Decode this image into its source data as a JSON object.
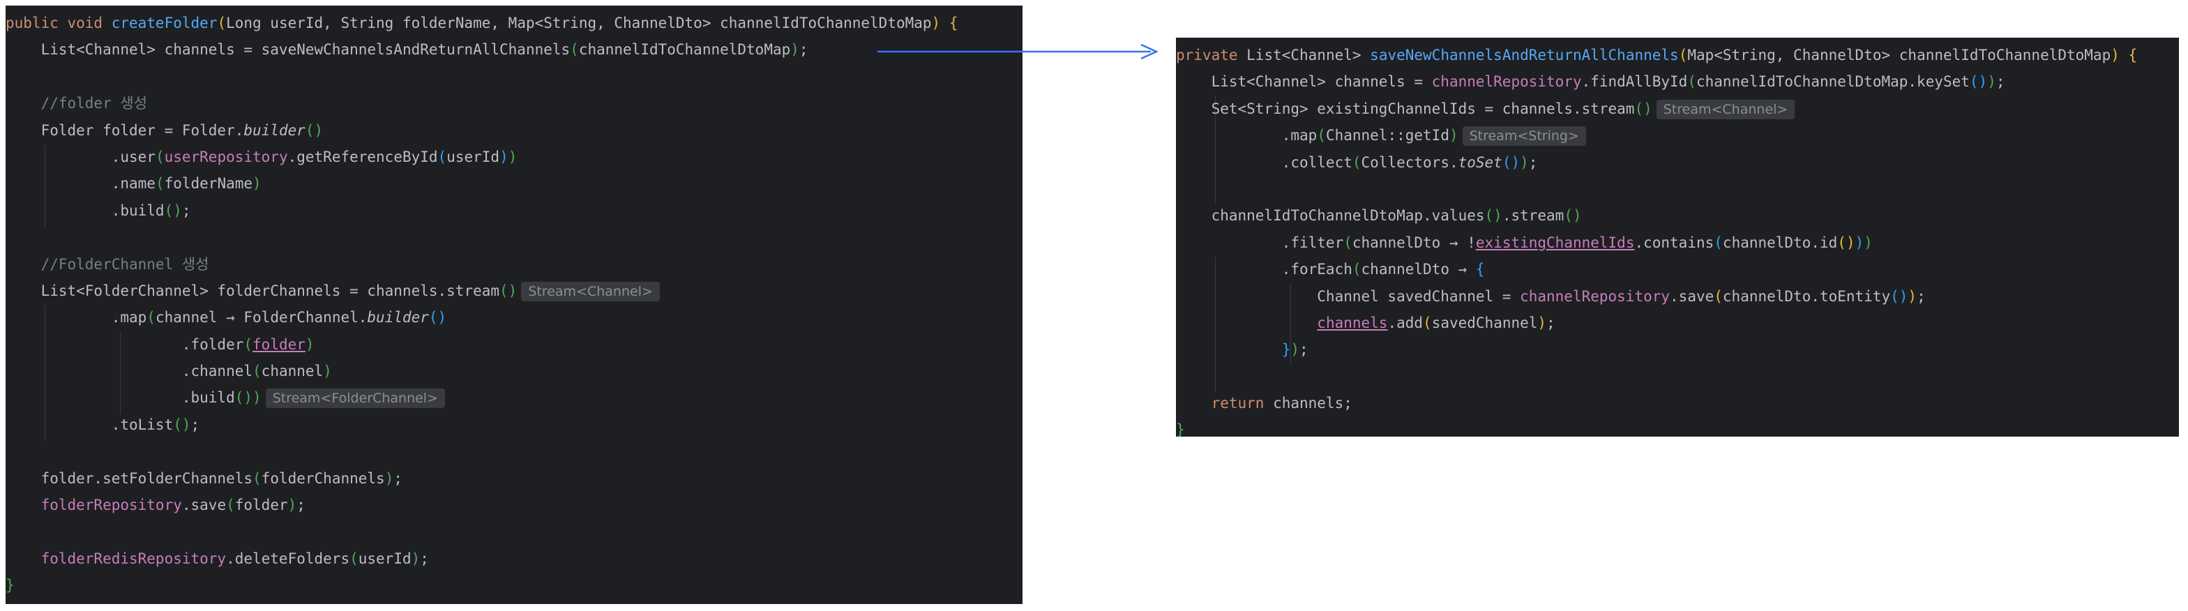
{
  "left": {
    "l1": {
      "t1": "public void ",
      "t2": "createFolder",
      "t3": "(",
      "t4": "Long userId, String folderName, Map<String, ChannelDto> channelIdToChannelDtoMap",
      "t5": ")",
      "t6": " {"
    },
    "l2": {
      "t1": "    List<Channel> channels = saveNewChannelsAndReturnAllChannels",
      "t2": "(",
      "t3": "channelIdToChannelDtoMap",
      "t4": ")",
      "t5": ";"
    },
    "l4": {
      "t1": "    //folder 생성"
    },
    "l5": {
      "t1": "    Folder folder = Folder.",
      "t2": "builder",
      "t3": "()"
    },
    "l6": {
      "t1": "            .user",
      "t2": "(",
      "t3": "userRepository",
      "t4": ".getReferenceById",
      "t5": "(",
      "t6": "userId",
      "t7": ")",
      "t8": ")"
    },
    "l7": {
      "t1": "            .name",
      "t2": "(",
      "t3": "folderName",
      "t4": ")"
    },
    "l8": {
      "t1": "            .build",
      "t2": "()",
      "t3": ";"
    },
    "l10": {
      "t1": "    //FolderChannel 생성"
    },
    "l11": {
      "t1": "    List<FolderChannel> folderChannels = channels.stream",
      "t2": "()",
      "hint": "Stream<Channel>"
    },
    "l12": {
      "t1": "            .map",
      "t2": "(",
      "t3": "channel → FolderChannel.",
      "t4": "builder",
      "t5": "()"
    },
    "l13": {
      "t1": "                    .folder",
      "t2": "(",
      "t3": "folder",
      "t4": ")"
    },
    "l14": {
      "t1": "                    .channel",
      "t2": "(",
      "t3": "channel",
      "t4": ")"
    },
    "l15": {
      "t1": "                    .build",
      "t2": "()",
      "t3": ")",
      "hint": "Stream<FolderChannel>"
    },
    "l16": {
      "t1": "            .toList",
      "t2": "()",
      "t3": ";"
    },
    "l18": {
      "t1": "    folder.setFolderChannels",
      "t2": "(",
      "t3": "folderChannels",
      "t4": ")",
      "t5": ";"
    },
    "l19": {
      "t1": "    folderRepository",
      "t2": ".save",
      "t3": "(",
      "t4": "folder",
      "t5": ")",
      "t6": ";"
    },
    "l21": {
      "t1": "    folderRedisRepository",
      "t2": ".deleteFolders",
      "t3": "(",
      "t4": "userId",
      "t5": ")",
      "t6": ";"
    },
    "l22": {
      "t1": "}"
    }
  },
  "right": {
    "r1": {
      "t1": "private ",
      "t2": "List<Channel> ",
      "t3": "saveNewChannelsAndReturnAllChannels",
      "t4": "(",
      "t5": "Map<String, ChannelDto> channelIdToChannelDtoMap",
      "t6": ")",
      "t7": " {"
    },
    "r2": {
      "t1": "    List<Channel> channels = ",
      "t2": "channelRepository",
      "t3": ".findAllById",
      "t4": "(",
      "t5": "channelIdToChannelDtoMap.keySet",
      "t6": "()",
      "t7": ")",
      "t8": ";"
    },
    "r3": {
      "t1": "    Set<String> existingChannelIds = channels.stream",
      "t2": "()",
      "hint": "Stream<Channel>"
    },
    "r4": {
      "t1": "            .map",
      "t2": "(",
      "t3": "Channel::getId",
      "t4": ")",
      "hint": "Stream<String>"
    },
    "r5": {
      "t1": "            .collect",
      "t2": "(",
      "t3": "Collectors.",
      "t4": "toSet",
      "t5": "()",
      "t6": ")",
      "t7": ";"
    },
    "r7": {
      "t1": "    channelIdToChannelDtoMap.values",
      "t2": "()",
      "t3": ".stream",
      "t4": "()"
    },
    "r8": {
      "t1": "            .filter",
      "t2": "(",
      "t3": "channelDto → !",
      "t4": "existingChannelIds",
      "t5": ".contains",
      "t6": "(",
      "t7": "channelDto.id",
      "t8": "()",
      "t9": ")",
      "t10": ")"
    },
    "r9": {
      "t1": "            .forEach",
      "t2": "(",
      "t3": "channelDto → ",
      "t4": "{"
    },
    "r10": {
      "t1": "                Channel savedChannel = ",
      "t2": "channelRepository",
      "t3": ".save",
      "t4": "(",
      "t5": "channelDto.toEntity",
      "t6": "()",
      "t7": ")",
      "t8": ";"
    },
    "r11": {
      "t1": "                ",
      "t2": "channels",
      "t3": ".add",
      "t4": "(",
      "t5": "savedChannel",
      "t6": ")",
      "t7": ";"
    },
    "r12": {
      "t1": "            ",
      "t2": "}",
      "t3": ")",
      "t4": ";"
    },
    "r14": {
      "t1": "    return ",
      "t2": "channels;"
    },
    "r15": {
      "t1": "}"
    }
  },
  "colors": {
    "background": "#1e1f22",
    "keyword": "#cf8e6d",
    "method": "#56a8f5",
    "field": "#c77dbb",
    "comment": "#7a7e85",
    "arrow": "#3574f0"
  }
}
